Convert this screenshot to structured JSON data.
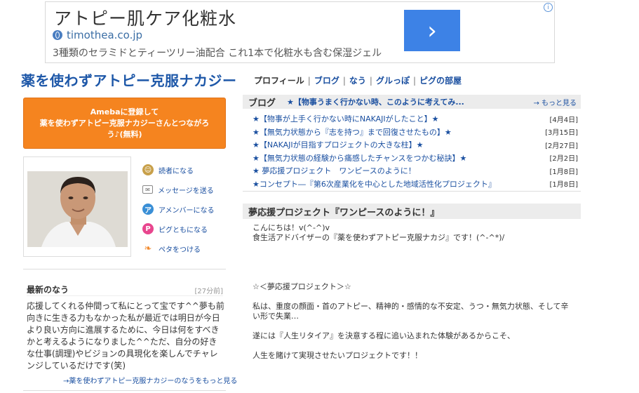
{
  "ad": {
    "title": "アトピー肌ケア化粧水",
    "domain": "timothea.co.jp",
    "description": "3種類のセラミドとティーツリー油配合 これ1本で化粧水も含む保湿ジェル",
    "arrow": "›",
    "info": "i"
  },
  "blog_title": "薬を使わずアトピー克服ナカジー",
  "nav": {
    "items": [
      "プロフィール",
      "ブログ",
      "なう",
      "グルっぽ",
      "ピグの部屋"
    ],
    "separator": "|"
  },
  "register": {
    "line1": "Amebaに登録して",
    "line2": "薬を使わずアトピー克服ナカジーさんとつながろ",
    "line3": "う♪(無料)"
  },
  "actions": [
    {
      "label": "読者になる",
      "icon": "reader-icon",
      "color": "#c8a04a"
    },
    {
      "label": "メッセージを送る",
      "icon": "mail-icon",
      "color": "#888888"
    },
    {
      "label": "アメンバーになる",
      "icon": "amember-icon",
      "color": "#3a8fd6"
    },
    {
      "label": "ピグともになる",
      "icon": "pigg-icon",
      "color": "#e8468e"
    },
    {
      "label": "ペタをつける",
      "icon": "footprint-icon",
      "color": "#f28a2e"
    }
  ],
  "latest_nau": {
    "title": "最新のなう",
    "time": "[27分前]",
    "body": "応援してくれる仲間って私にとって宝です^^夢も前向きに生きる力もなかった私が最近では明日が今日より良い方向に進展するために、今日は何をすべきかと考えるようになりました^^ただ、自分の好きな仕事(調理)やビジョンの具現化を楽しんでチャレンジしているだけです(笑)",
    "more": "→薬を使わずアトピー克服ナカジーのなうをもっと見る"
  },
  "blog": {
    "label": "ブログ",
    "first": "★【物事うまく行かない時、このように考えてみ...",
    "more": "→ もっと見る",
    "entries": [
      {
        "title": "★【物事が上手く行かない時にNAKAJIがしたこと】★",
        "date": "[4月4日]"
      },
      {
        "title": "★【無気力状態から『志を持つ』まで回復させたもの】★",
        "date": "[3月15日]"
      },
      {
        "title": "★【NAKAJIが目指すプロジェクトの大きな柱】★",
        "date": "[2月27日]"
      },
      {
        "title": "★【無気力状態の経験から痛感したチャンスをつかむ秘訣】★",
        "date": "[2月2日]"
      },
      {
        "title": "★ 夢応援プロジェクト　ワンピースのように！",
        "date": "[1月8日]"
      },
      {
        "title": "★コンセプト―『第6次産業化を中心とした地域活性化プロジェクト』",
        "date": "[1月8日]"
      }
    ]
  },
  "article": {
    "title": "夢応援プロジェクト『ワンピースのように！』",
    "paragraphs": [
      "こんにちは！v(^-^)v",
      "食生活アドバイザーの『薬を使わずアトピー克服ナカジ』です！(^-^*)/",
      "",
      "",
      "",
      "☆＜夢応援プロジェクト＞☆",
      "",
      "私は、重度の顔面・首のアトピー、精神的・感情的な不安定、うつ・無気力状態、そして辛い形で失業…",
      "",
      "遂には『人生リタイア』を決意する程に追い込まれた体験があるからこそ、",
      "",
      "人生を賭けて実現させたいプロジェクトです！！"
    ]
  }
}
